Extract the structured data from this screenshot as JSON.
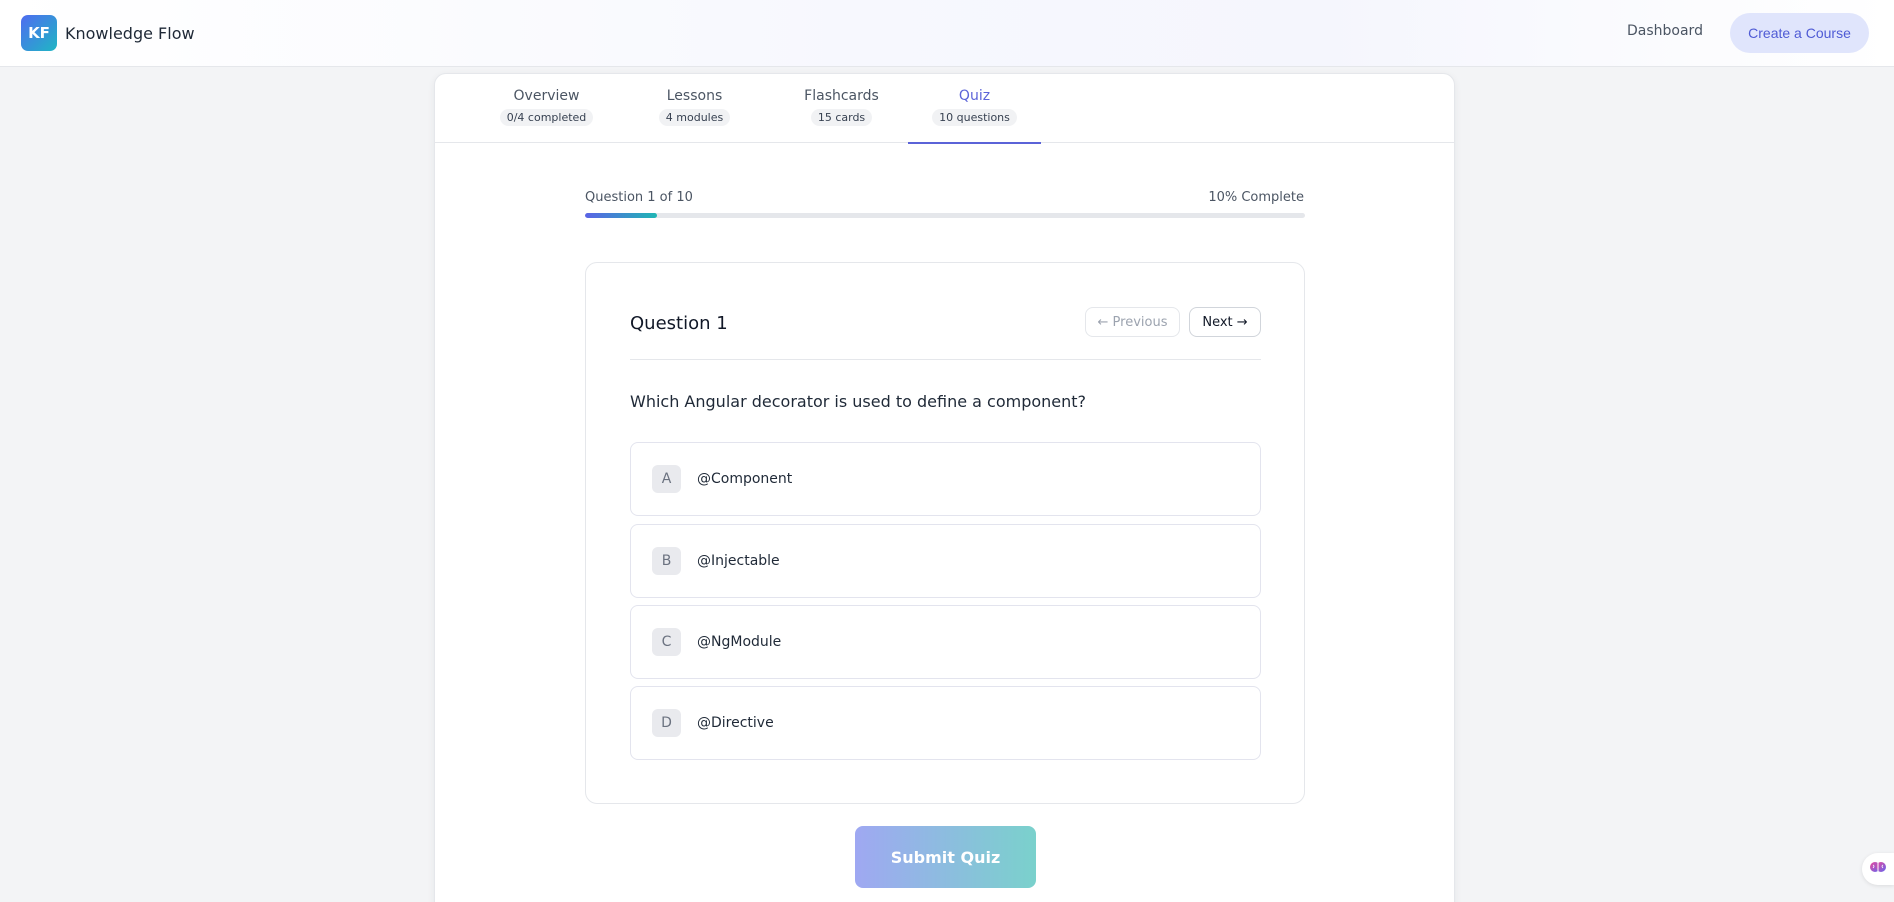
{
  "header": {
    "logo_text": "KF",
    "app_name": "Knowledge Flow",
    "nav_dashboard": "Dashboard",
    "create_course_label": "Create a Course"
  },
  "tabs": [
    {
      "label": "Overview",
      "badge": "0/4 completed",
      "active": false
    },
    {
      "label": "Lessons",
      "badge": "4 modules",
      "active": false
    },
    {
      "label": "Flashcards",
      "badge": "15 cards",
      "active": false
    },
    {
      "label": "Quiz",
      "badge": "10 questions",
      "active": true
    }
  ],
  "progress": {
    "label": "Question 1 of 10",
    "complete_label": "10% Complete",
    "percent": 10
  },
  "question": {
    "title": "Question 1",
    "prev_label": "← Previous",
    "next_label": "Next →",
    "text": "Which Angular decorator is used to define a component?",
    "options": [
      {
        "letter": "A",
        "text": "@Component"
      },
      {
        "letter": "B",
        "text": "@Injectable"
      },
      {
        "letter": "C",
        "text": "@NgModule"
      },
      {
        "letter": "D",
        "text": "@Directive"
      }
    ]
  },
  "submit_label": "Submit Quiz",
  "colors": {
    "accent": "#5b63d8",
    "progress_start": "#5b63e6",
    "progress_end": "#1fb6b4"
  },
  "icons": {
    "floating_widget": "brain-icon"
  }
}
